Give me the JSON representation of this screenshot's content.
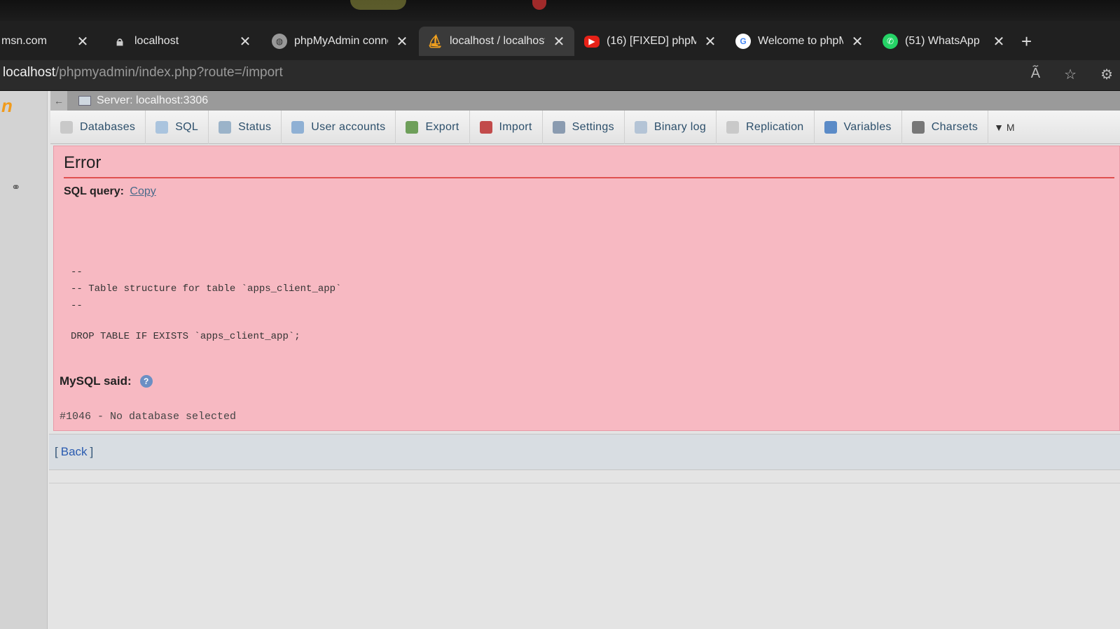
{
  "browser": {
    "tabs": [
      {
        "title": "msn.com",
        "icon": "globe-icon"
      },
      {
        "title": "localhost",
        "icon": "lock-icon"
      },
      {
        "title": "phpMyAdmin conne",
        "icon": "globe-icon"
      },
      {
        "title": "localhost / localhost",
        "icon": "phpmyadmin-icon"
      },
      {
        "title": "(16) [FIXED] phpMy",
        "icon": "youtube-icon"
      },
      {
        "title": "Welcome to phpMy",
        "icon": "google-icon"
      },
      {
        "title": "(51) WhatsApp",
        "icon": "whatsapp-icon"
      }
    ],
    "new_tab_label": "+",
    "url_host": "localhost",
    "url_path": "/phpmyadmin/index.php?route=/import"
  },
  "sidebar": {
    "logo_fragment": "n"
  },
  "server_bar": {
    "label": "Server: localhost:3306"
  },
  "nav": {
    "items": [
      {
        "label": "Databases"
      },
      {
        "label": "SQL"
      },
      {
        "label": "Status"
      },
      {
        "label": "User accounts"
      },
      {
        "label": "Export"
      },
      {
        "label": "Import"
      },
      {
        "label": "Settings"
      },
      {
        "label": "Binary log"
      },
      {
        "label": "Replication"
      },
      {
        "label": "Variables"
      },
      {
        "label": "Charsets"
      }
    ],
    "more_label": "M"
  },
  "error": {
    "heading": "Error",
    "sql_query_label": "SQL query:",
    "copy_label": "Copy",
    "code_lines": [
      "--",
      "-- Table structure for table `apps_client_app`",
      "--",
      "DROP TABLE IF EXISTS `apps_client_app`;"
    ],
    "mysql_said_label": "MySQL said:",
    "message": "#1046 - No database selected"
  },
  "footer": {
    "back_open": "[",
    "back_label": "Back",
    "back_close": "]"
  },
  "colors": {
    "error_bg": "#f7b9c2",
    "error_rule": "#e05050",
    "link": "#2a5bb0"
  }
}
